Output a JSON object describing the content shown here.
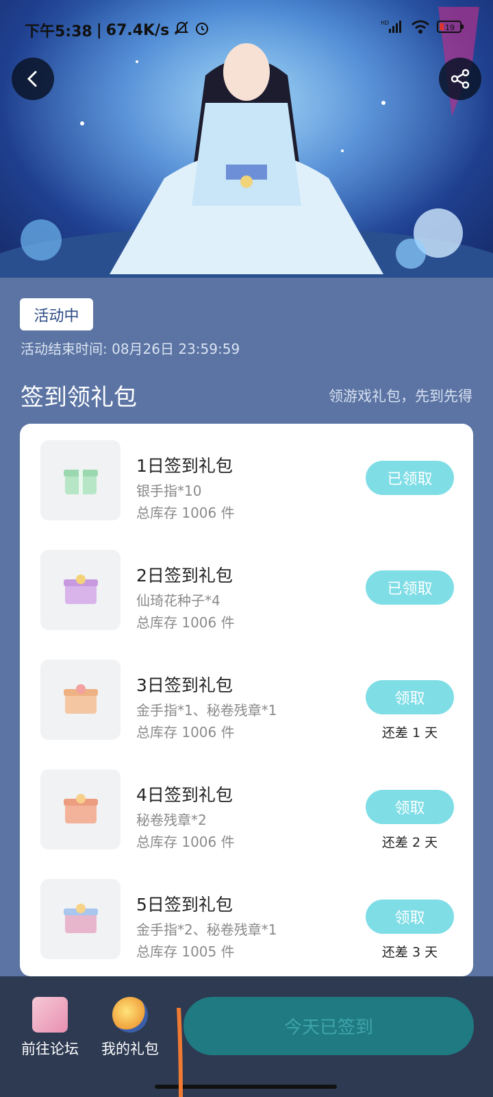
{
  "status_bar": {
    "time": "下午5:38",
    "speed": "67.4K/s",
    "network": "HD",
    "battery": "19"
  },
  "activity": {
    "status": "活动中",
    "end_time": "活动结束时间: 08月26日 23:59:59"
  },
  "section": {
    "title": "签到领礼包",
    "subtitle": "领游戏礼包，先到先得"
  },
  "gifts": [
    {
      "title": "1日签到礼包",
      "desc": "银手指*10",
      "stock": "总库存 1006 件",
      "button": "已领取",
      "remain": "",
      "color": "#b6e6c6"
    },
    {
      "title": "2日签到礼包",
      "desc": "仙琦花种子*4",
      "stock": "总库存 1006 件",
      "button": "已领取",
      "remain": "",
      "color": "#d8b4ea"
    },
    {
      "title": "3日签到礼包",
      "desc": "金手指*1、秘卷残章*1",
      "stock": "总库存 1006 件",
      "button": "领取",
      "remain": "还差 1 天",
      "color": "#f4c7a2"
    },
    {
      "title": "4日签到礼包",
      "desc": "秘卷残章*2",
      "stock": "总库存 1006 件",
      "button": "领取",
      "remain": "还差 2 天",
      "color": "#f3b39a"
    },
    {
      "title": "5日签到礼包",
      "desc": "金手指*2、秘卷残章*1",
      "stock": "总库存 1005 件",
      "button": "领取",
      "remain": "还差 3 天",
      "color": "#e7b6cd"
    }
  ],
  "bottom": {
    "forum_label": "前往论坛",
    "mygifts_label": "我的礼包",
    "signed_label": "今天已签到"
  },
  "colors": {
    "page_bg": "#5b74a3",
    "button_bg": "#7fdde6",
    "bottom_bar": "#2d3a52",
    "signed_button": "#1f7a82"
  }
}
